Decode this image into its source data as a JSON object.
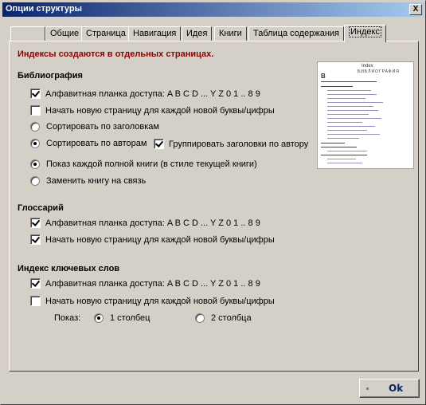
{
  "window": {
    "title": "Опции структуры",
    "close_label": "X"
  },
  "tabs": [
    {
      "label": ""
    },
    {
      "label": "Общие"
    },
    {
      "label": "Страница"
    },
    {
      "label": "Навигация"
    },
    {
      "label": "Идея"
    },
    {
      "label": "Книги"
    },
    {
      "label": "Таблица содержания"
    },
    {
      "label": "Индекс"
    }
  ],
  "active_tab": "Индекс",
  "notice": "Индексы создаются в отдельных страницах.",
  "bibliography": {
    "title": "Библиография",
    "alpha_bar": {
      "label": "Алфавитная планка доступа: A B C D ... Y Z 0 1 .. 8 9",
      "checked": true
    },
    "new_page": {
      "label": "Начать новую страницу для каждой новой буквы/цифры",
      "checked": false
    },
    "sort_titles": {
      "label": "Сортировать по заголовкам",
      "checked": false
    },
    "sort_authors": {
      "label": "Сортировать по авторам",
      "checked": true
    },
    "group_titles": {
      "label": "Группировать заголовки по автору",
      "checked": true
    },
    "show_full_book": {
      "label": "Показ каждой полной книги (в стиле текущей книги)",
      "checked": true
    },
    "replace_link": {
      "label": "Заменить книгу на связь",
      "checked": false
    }
  },
  "glossary": {
    "title": "Глоссарий",
    "alpha_bar": {
      "label": "Алфавитная планка доступа: A B C D ... Y Z 0 1 .. 8 9",
      "checked": true
    },
    "new_page": {
      "label": "Начать новую страницу для каждой новой буквы/цифры",
      "checked": true
    }
  },
  "keywords": {
    "title": "Индекс ключевых слов",
    "alpha_bar": {
      "label": "Алфавитная планка доступа: A B C D ... Y Z 0 1 .. 8 9",
      "checked": true
    },
    "new_page": {
      "label": "Начать новую страницу для каждой новой буквы/цифры",
      "checked": false
    },
    "show_label": "Показ:",
    "one_column": {
      "label": "1 столбец",
      "checked": true
    },
    "two_columns": {
      "label": "2 столбца",
      "checked": false
    }
  },
  "ok_label": "Ok",
  "colors": {
    "notice": "#8b0000",
    "titlebar": "#0a246a",
    "face": "#d4d0c8"
  }
}
